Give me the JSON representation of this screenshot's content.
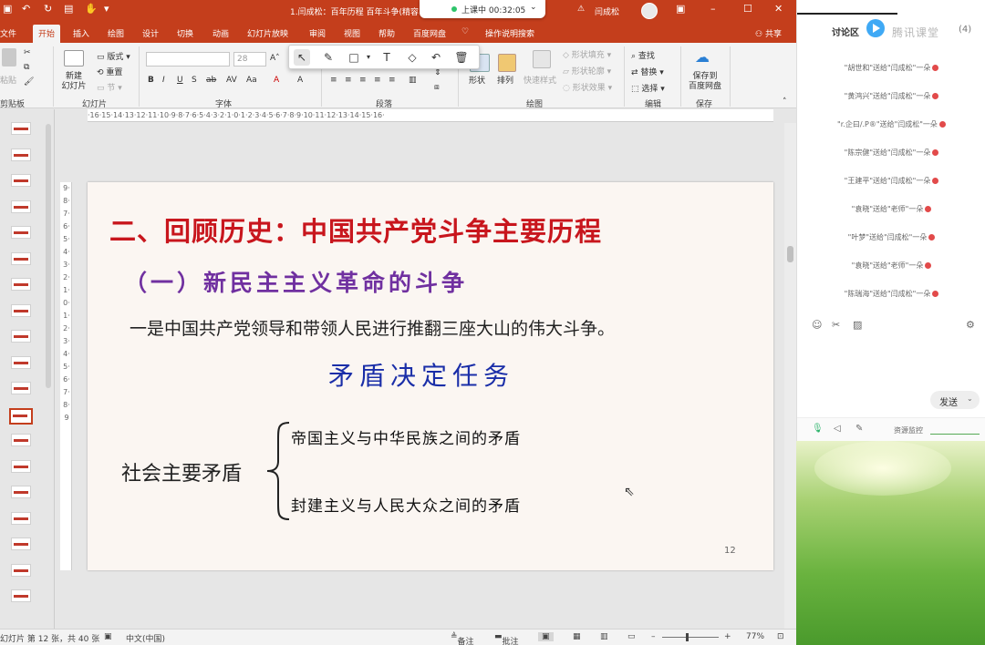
{
  "titlebar": {
    "doc_title": "1.闫成松：百年历程 百年斗争(精容",
    "live_status": "上课中 00:32:05",
    "user_name": "闫成松"
  },
  "tabs": [
    {
      "label": "文件"
    },
    {
      "label": "开始"
    },
    {
      "label": "插入"
    },
    {
      "label": "绘图"
    },
    {
      "label": "设计"
    },
    {
      "label": "切换"
    },
    {
      "label": "动画"
    },
    {
      "label": "幻灯片放映"
    },
    {
      "label": "审阅"
    },
    {
      "label": "视图"
    },
    {
      "label": "帮助"
    },
    {
      "label": "百度网盘"
    },
    {
      "label": "操作说明搜索"
    }
  ],
  "share_label": "共享",
  "ribbon": {
    "clipboard": {
      "paste": "粘贴",
      "label": "剪贴板"
    },
    "slides": {
      "new_slide": "新建\n幻灯片",
      "layout": "版式",
      "reset": "重置",
      "section": "节",
      "label": "幻灯片"
    },
    "font": {
      "size": "28",
      "label": "字体"
    },
    "paragraph": {
      "label": "段落"
    },
    "drawing": {
      "shapes": "形状",
      "arrange": "排列",
      "quick_styles": "快速样式",
      "fill": "形状填充",
      "outline": "形状轮廓",
      "effects": "形状效果",
      "label": "绘图"
    },
    "editing": {
      "find": "查找",
      "replace": "替换",
      "select": "选择",
      "label": "编辑"
    },
    "save": {
      "save_to_cloud": "保存到\n百度网盘",
      "label": "保存"
    }
  },
  "ruler_h": "·16·15·14·13·12·11·10·9·8·7·6·5·4·3·2·1·0·1·2·3·4·5·6·7·8·9·10·11·12·13·14·15·16·",
  "ruler_v": "9·8·7·6·5·4·3·2·1·0·1·2·3·4·5·6·7·8·9",
  "slide": {
    "title": "二、回顾历史：中国共产党斗争主要历程",
    "subtitle": "（一）新民主主义革命的斗争",
    "body": "一是中国共产党领导和带领人民进行推翻三座大山的伟大斗争。",
    "heading2": "矛盾决定任务",
    "left_label": "社会主要矛盾",
    "branch1": "帝国主义与中华民族之间的矛盾",
    "branch2": "封建主义与人民大众之间的矛盾",
    "page_number": "12"
  },
  "thumbnail_count": 19,
  "selected_thumbnail": 12,
  "status": {
    "slide_info": "幻灯片 第 12 张，共 40 张",
    "language": "中文(中国)",
    "notes": "备注",
    "comments": "批注",
    "zoom": "77%"
  },
  "chat": {
    "title": "讨论区",
    "brand": "腾讯课堂",
    "count": "(4)",
    "messages": [
      "\"胡世和\"送给\"闫成松\"一朵",
      "\"黄鸿兴\"送给\"闫成松\"一朵",
      "\"r.企曰/.P®\"送给\"闫成松\"一朵",
      "\"陈宗健\"送给\"闫成松\"一朵",
      "\"王建平\"送给\"闫成松\"一朵",
      "\"袁晓\"送给\"老师\"一朵",
      "\"叶梦\"送给\"闫成松\"一朵",
      "\"袁晓\"送给\"老师\"一朵",
      "\"陈瑞海\"送给\"闫成松\"一朵"
    ],
    "send_label": "发送",
    "resource_monitor": "资源监控"
  },
  "colors": {
    "ppt_accent": "#c43e1c",
    "title_red": "#c8161d",
    "subtitle_purple": "#7030a0",
    "heading_blue": "#1a2ea8"
  }
}
